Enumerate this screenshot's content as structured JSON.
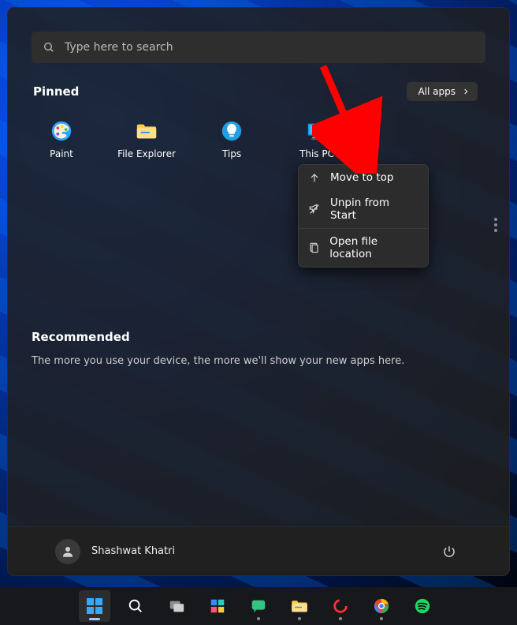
{
  "search": {
    "placeholder": "Type here to search"
  },
  "pinned": {
    "heading": "Pinned",
    "all_apps_label": "All apps",
    "apps": [
      {
        "label": "Paint",
        "icon": "paint-icon"
      },
      {
        "label": "File Explorer",
        "icon": "file-explorer-icon"
      },
      {
        "label": "Tips",
        "icon": "tips-icon"
      },
      {
        "label": "This PC",
        "icon": "this-pc-icon"
      }
    ]
  },
  "context_menu": {
    "items": [
      {
        "label": "Move to top",
        "icon": "arrow-up-icon"
      },
      {
        "label": "Unpin from Start",
        "icon": "unpin-icon"
      },
      {
        "label": "Open file location",
        "icon": "file-location-icon"
      }
    ]
  },
  "recommended": {
    "heading": "Recommended",
    "empty_text": "The more you use your device, the more we'll show your new apps here."
  },
  "footer": {
    "user_name": "Shashwat Khatri"
  },
  "taskbar": {
    "items": [
      {
        "name": "start-button",
        "active": true,
        "running": false
      },
      {
        "name": "search-button",
        "active": false,
        "running": false
      },
      {
        "name": "task-view-button",
        "active": false,
        "running": false
      },
      {
        "name": "widgets-button",
        "active": false,
        "running": false
      },
      {
        "name": "chat-button",
        "active": false,
        "running": true
      },
      {
        "name": "file-explorer-task",
        "active": false,
        "running": true
      },
      {
        "name": "app-red-circle",
        "active": false,
        "running": true
      },
      {
        "name": "chrome-task",
        "active": false,
        "running": true
      },
      {
        "name": "spotify-task",
        "active": false,
        "running": false
      }
    ]
  },
  "annotation": {
    "arrow_color": "#ff0000"
  }
}
